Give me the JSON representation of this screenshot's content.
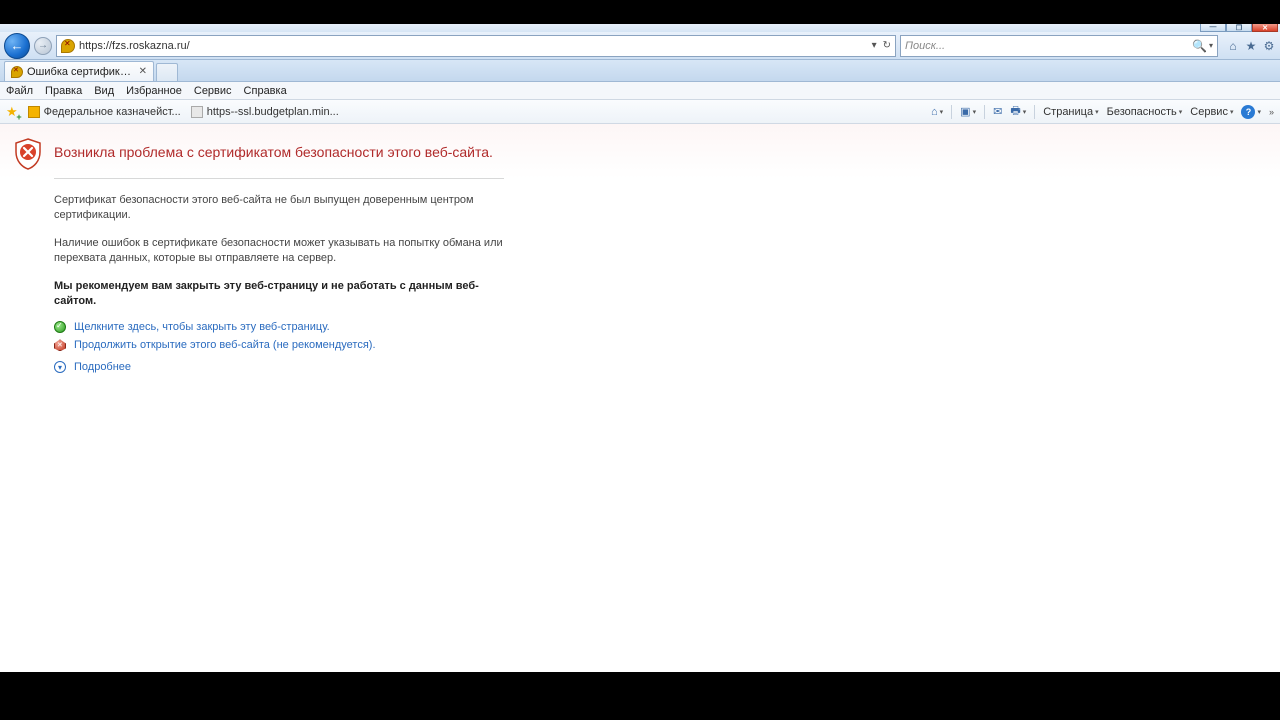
{
  "window_controls": {
    "minimize": "—",
    "restore": "❐",
    "close": "✕"
  },
  "address": {
    "url": "https://fzs.roskazna.ru/"
  },
  "search": {
    "placeholder": "Поиск..."
  },
  "tab": {
    "title": "Ошибка сертификата: пе..."
  },
  "menu": {
    "file": "Файл",
    "edit": "Правка",
    "view": "Вид",
    "favorites": "Избранное",
    "tools": "Сервис",
    "help": "Справка"
  },
  "favorites": {
    "item1": "Федеральное казначейст...",
    "item2": "https--ssl.budgetplan.min..."
  },
  "cmdbar": {
    "page": "Страница",
    "safety": "Безопасность",
    "service": "Сервис"
  },
  "cert": {
    "title": "Возникла проблема с сертификатом безопасности этого веб-сайта.",
    "p1": "Сертификат безопасности этого веб-сайта не был выпущен доверенным центром сертификации.",
    "p2": "Наличие ошибок в сертификате безопасности может указывать на попытку обмана или перехвата данных, которые вы отправляете на сервер.",
    "p3": "Мы рекомендуем вам закрыть эту веб-страницу и не работать с данным веб-сайтом.",
    "close_link": "Щелкните здесь, чтобы закрыть эту веб-страницу.",
    "continue_link": "Продолжить открытие этого веб-сайта (не рекомендуется).",
    "more": "Подробнее"
  }
}
